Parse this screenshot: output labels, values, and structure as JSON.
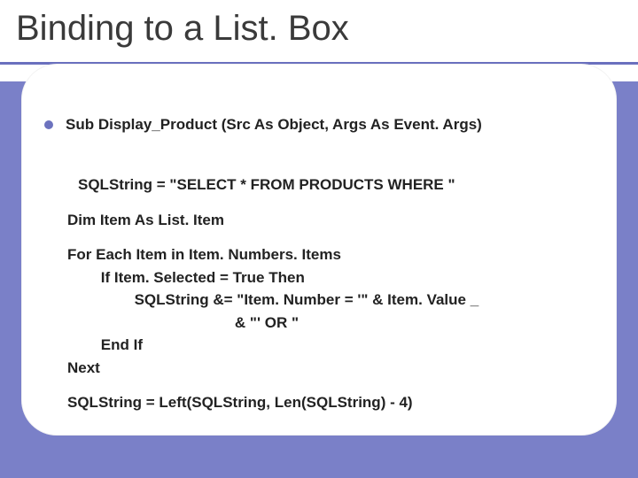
{
  "title": "Binding to a List. Box",
  "bullet": "Sub Display_Product (Src As Object, Args As Event. Args)",
  "code": {
    "line1": "SQLString = \"SELECT * FROM PRODUCTS WHERE \"",
    "line2": "Dim Item As List. Item",
    "line3": "For Each Item in Item. Numbers. Items",
    "line4": "        If Item. Selected = True Then",
    "line5": "                SQLString &= \"Item. Number = '\" & Item. Value _",
    "line6": "                                        & \"' OR \"",
    "line7": "        End If",
    "line8": "Next",
    "line9": "SQLString = Left(SQLString, Len(SQLString) - 4)"
  }
}
